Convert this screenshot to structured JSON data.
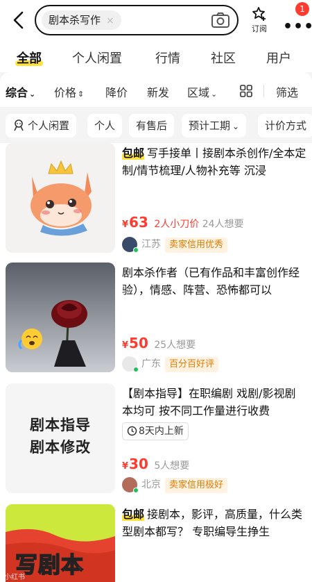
{
  "search": {
    "query": "剧本杀写作",
    "clear_glyph": "×",
    "camera_icon": "camera-icon"
  },
  "header": {
    "subscribe_label": "订阅",
    "more_badge": "1"
  },
  "tabs": [
    "全部",
    "个人闲置",
    "行情",
    "社区",
    "用户"
  ],
  "filters": {
    "composite": "综合",
    "price": "价格",
    "price_down": "降价",
    "new": "新发",
    "region": "区域",
    "filter": "筛选"
  },
  "tags": [
    "个人闲置",
    "个人",
    "有售后",
    "预计工期",
    "计价方式"
  ],
  "listings": [
    {
      "badge": "包邮",
      "title": "写手接单丨接剧本杀创作/全本定制/情节梳理/人物补充等 沉浸",
      "price": "63",
      "currency": "¥",
      "bargain": "2人小刀价",
      "wants": "24人想要",
      "location": "江苏",
      "credit": "卖家信用优秀"
    },
    {
      "badge": "",
      "title": "剧本杀作者（已有作品和丰富创作经验），情感、阵营、恐怖都可以",
      "price": "50",
      "currency": "¥",
      "bargain": "",
      "wants": "25人想要",
      "location": "广东",
      "credit": "百分百好评"
    },
    {
      "badge": "",
      "title": "【剧本指导】在职编剧 戏剧/影视剧本均可 按不同工作量进行收费",
      "new_tag": "8天内上新",
      "thumb_text": [
        "剧本指导",
        "剧本修改"
      ],
      "price": "30",
      "currency": "¥",
      "bargain": "",
      "wants": "5人想要",
      "location": "北京",
      "credit": "卖家信用极好"
    },
    {
      "badge": "包邮",
      "title": "接剧本，影评，高质量，什么类型剧本都写？ 专职编导生挣生",
      "thumb_text": "写剧本"
    }
  ],
  "watermark": "小红书"
}
